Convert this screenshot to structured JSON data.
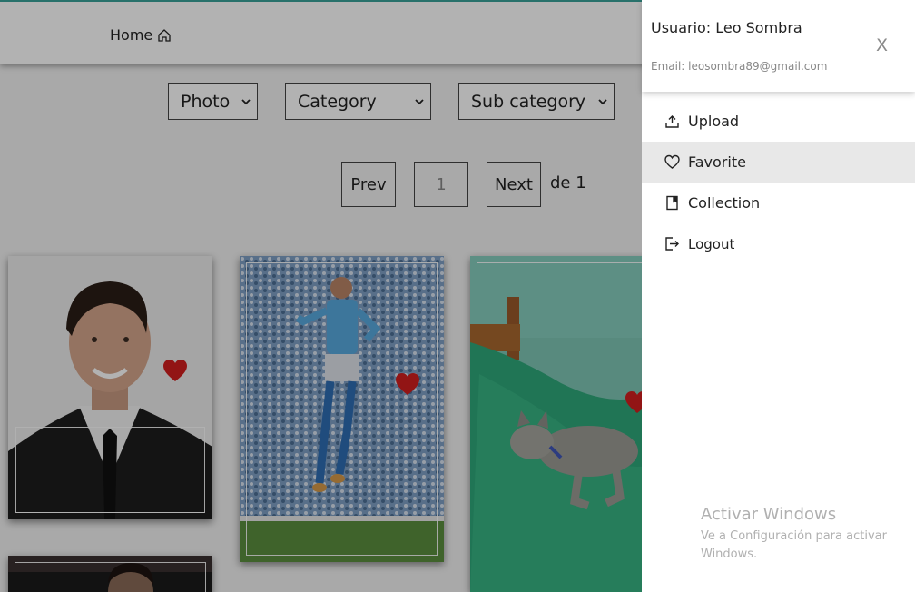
{
  "header": {
    "home_label": "Home",
    "home_icon": "home-icon"
  },
  "filters": {
    "media_type": "Photo",
    "category": "Category",
    "sub_category": "Sub category"
  },
  "pagination": {
    "prev_label": "Prev",
    "current_page": "1",
    "next_label": "Next",
    "total_label": "de 1"
  },
  "gallery": {
    "cards": [
      {
        "subject": "portrait",
        "favorite": true
      },
      {
        "subject": "football-player",
        "favorite": true
      },
      {
        "subject": "cat-on-bed",
        "favorite": true
      },
      {
        "subject": "portrait-dark",
        "favorite": false
      }
    ]
  },
  "drawer": {
    "user_label": "Usuario: Leo Sombra",
    "email_label": "Email: leosombra89@gmail.com",
    "close_label": "X",
    "menu": [
      {
        "label": "Upload",
        "icon": "upload-icon",
        "active": false
      },
      {
        "label": "Favorite",
        "icon": "heart-icon",
        "active": true
      },
      {
        "label": "Collection",
        "icon": "book-icon",
        "active": false
      },
      {
        "label": "Logout",
        "icon": "logout-icon",
        "active": false
      }
    ]
  },
  "watermark": {
    "title": "Activar Windows",
    "subtitle": "Ve a Configuración para activar Windows."
  },
  "colors": {
    "accent_top": "#3aa39a",
    "heart": "#d11f1f",
    "overlay": "rgba(0,0,0,0.30)",
    "active_menu": "#e8e8e8"
  }
}
